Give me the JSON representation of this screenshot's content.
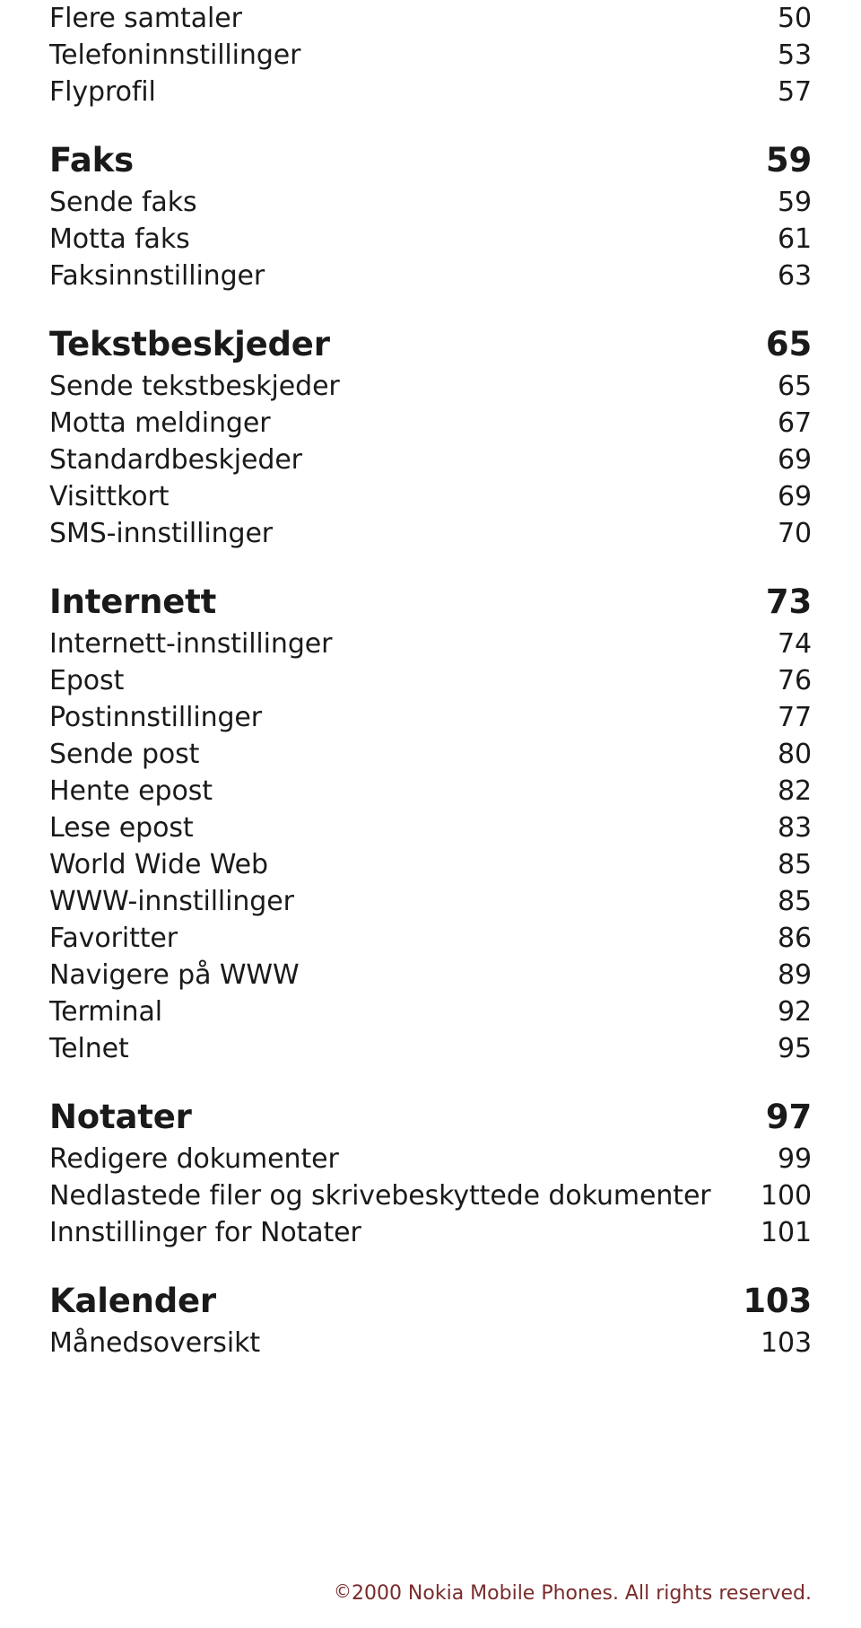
{
  "document": {
    "type": "table-of-contents",
    "language": "no",
    "copyright_symbol": "©",
    "copyright_text": "2000 Nokia Mobile Phones. All rights reserved."
  },
  "toc": {
    "entries": [
      {
        "label": "Flere samtaler",
        "page": "50",
        "level": 2,
        "gap_before": false
      },
      {
        "label": "Telefoninnstillinger",
        "page": "53",
        "level": 2,
        "gap_before": false
      },
      {
        "label": "Flyprofil",
        "page": "57",
        "level": 2,
        "gap_before": false
      },
      {
        "label": "Faks",
        "page": "59",
        "level": 1,
        "gap_before": true
      },
      {
        "label": "Sende faks",
        "page": "59",
        "level": 2,
        "gap_before": false
      },
      {
        "label": "Motta faks",
        "page": "61",
        "level": 2,
        "gap_before": false
      },
      {
        "label": "Faksinnstillinger",
        "page": "63",
        "level": 2,
        "gap_before": false
      },
      {
        "label": "Tekstbeskjeder",
        "page": "65",
        "level": 1,
        "gap_before": true
      },
      {
        "label": "Sende tekstbeskjeder",
        "page": "65",
        "level": 2,
        "gap_before": false
      },
      {
        "label": "Motta meldinger",
        "page": "67",
        "level": 2,
        "gap_before": false
      },
      {
        "label": "Standardbeskjeder",
        "page": "69",
        "level": 2,
        "gap_before": false
      },
      {
        "label": "Visittkort",
        "page": "69",
        "level": 2,
        "gap_before": false
      },
      {
        "label": "SMS-innstillinger",
        "page": "70",
        "level": 2,
        "gap_before": false
      },
      {
        "label": "Internett",
        "page": "73",
        "level": 1,
        "gap_before": true
      },
      {
        "label": "Internett-innstillinger",
        "page": "74",
        "level": 2,
        "gap_before": false
      },
      {
        "label": "Epost",
        "page": "76",
        "level": 2,
        "gap_before": false
      },
      {
        "label": "Postinnstillinger",
        "page": "77",
        "level": 2,
        "gap_before": false
      },
      {
        "label": "Sende post",
        "page": "80",
        "level": 2,
        "gap_before": false
      },
      {
        "label": "Hente epost",
        "page": "82",
        "level": 2,
        "gap_before": false
      },
      {
        "label": "Lese epost",
        "page": "83",
        "level": 2,
        "gap_before": false
      },
      {
        "label": "World Wide Web",
        "page": "85",
        "level": 2,
        "gap_before": false
      },
      {
        "label": "WWW-innstillinger",
        "page": "85",
        "level": 2,
        "gap_before": false
      },
      {
        "label": "Favoritter",
        "page": "86",
        "level": 2,
        "gap_before": false
      },
      {
        "label": "Navigere på WWW",
        "page": "89",
        "level": 2,
        "gap_before": false
      },
      {
        "label": "Terminal",
        "page": "92",
        "level": 2,
        "gap_before": false
      },
      {
        "label": "Telnet",
        "page": "95",
        "level": 2,
        "gap_before": false
      },
      {
        "label": "Notater",
        "page": "97",
        "level": 1,
        "gap_before": true
      },
      {
        "label": "Redigere dokumenter",
        "page": "99",
        "level": 2,
        "gap_before": false
      },
      {
        "label": "Nedlastede filer og skrivebeskyttede dokumenter",
        "page": "100",
        "level": 2,
        "gap_before": false
      },
      {
        "label": "Innstillinger for Notater",
        "page": "101",
        "level": 2,
        "gap_before": false
      },
      {
        "label": "Kalender",
        "page": "103",
        "level": 1,
        "gap_before": true
      },
      {
        "label": "Månedsoversikt",
        "page": "103",
        "level": 2,
        "gap_before": false
      }
    ]
  }
}
